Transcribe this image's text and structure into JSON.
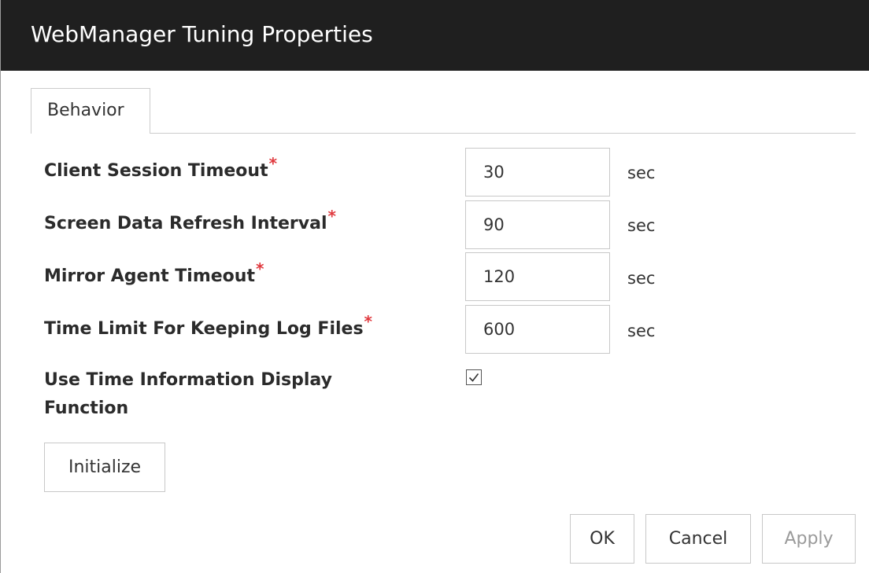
{
  "window": {
    "title": "WebManager Tuning Properties"
  },
  "tabs": [
    {
      "label": "Behavior",
      "active": true
    }
  ],
  "fields": [
    {
      "label": "Client Session Timeout",
      "required_mark": "*",
      "value": "30",
      "unit": "sec"
    },
    {
      "label": "Screen Data Refresh Interval",
      "required_mark": "*",
      "value": "90",
      "unit": "sec"
    },
    {
      "label": "Mirror Agent Timeout",
      "required_mark": "*",
      "value": "120",
      "unit": "sec"
    },
    {
      "label": "Time Limit For Keeping Log Files",
      "required_mark": "*",
      "value": "600",
      "unit": "sec"
    }
  ],
  "time_info_option": {
    "label": "Use Time Information Display Function",
    "checked": true
  },
  "buttons": {
    "initialize": "Initialize",
    "ok": "OK",
    "cancel": "Cancel",
    "apply": "Apply"
  },
  "colors": {
    "titlebar_bg": "#1f1f1f",
    "required_mark": "#e0393e",
    "border": "#c8c8c8",
    "disabled_text": "#9a9a9a"
  }
}
